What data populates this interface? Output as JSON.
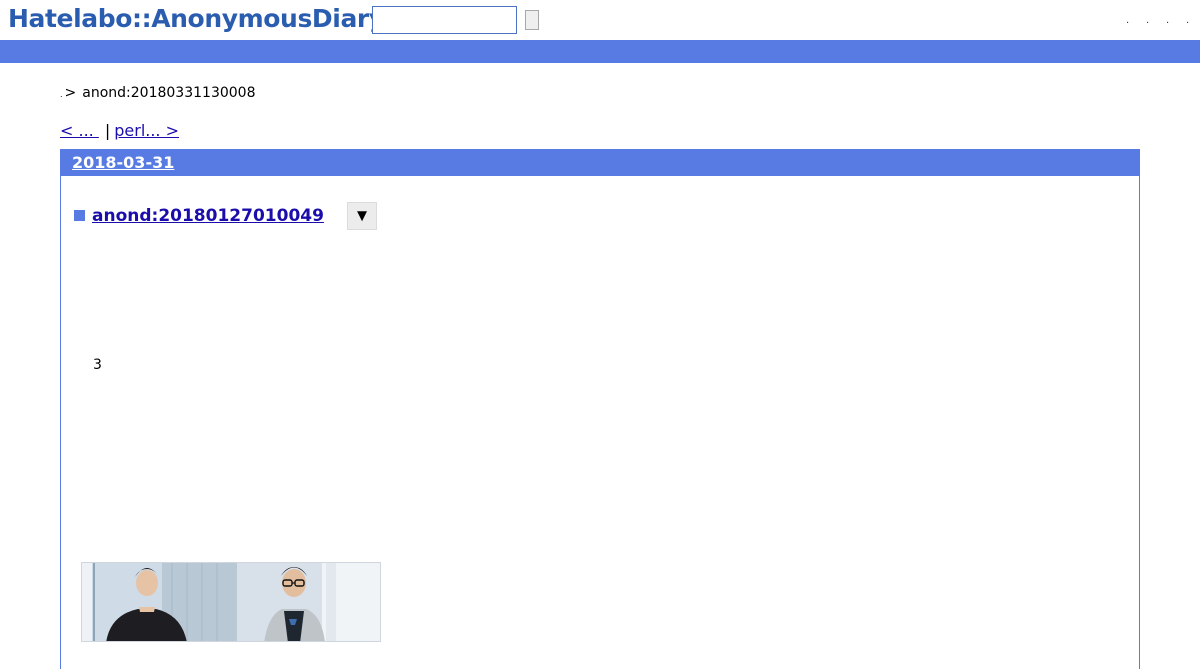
{
  "header": {
    "logo": "Hatelabo::AnonymousDiary",
    "search": {
      "value": "",
      "placeholder": ""
    },
    "links": [
      ".",
      ".",
      ".",
      "."
    ]
  },
  "breadcrumb": {
    "home_label": ".",
    "separator": ">",
    "current": "anond:20180331130008"
  },
  "pager": {
    "prev_label": "< ... ",
    "separator": "|",
    "next_label": "perl... > "
  },
  "day": {
    "date": "2018-03-31",
    "entry": {
      "anchor_icon": "square-anchor-icon",
      "title": "anond:20180127010049",
      "toggle_label": "▼",
      "body": [
        "3"
      ]
    }
  },
  "colors": {
    "accent": "#577be3",
    "logo": "#2a5db0",
    "link": "#1a0dab"
  }
}
